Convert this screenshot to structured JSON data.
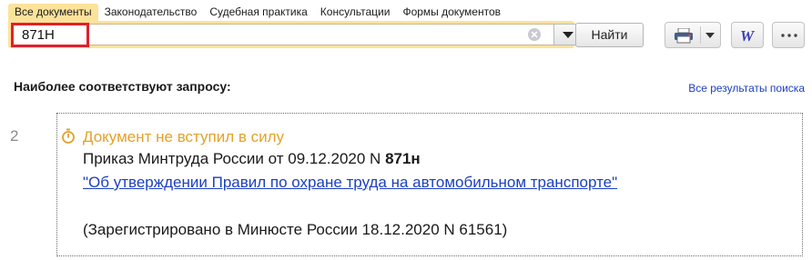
{
  "tabs": [
    {
      "label": "Все документы",
      "active": true
    },
    {
      "label": "Законодательство",
      "active": false
    },
    {
      "label": "Судебная практика",
      "active": false
    },
    {
      "label": "Консультации",
      "active": false
    },
    {
      "label": "Формы документов",
      "active": false
    }
  ],
  "search": {
    "value": "871Н",
    "find_label": "Найти"
  },
  "toolbar": {
    "word_letter": "W"
  },
  "results": {
    "heading": "Наиболее соответствуют запросу:",
    "all_link": "Все результаты поиска",
    "items": [
      {
        "number": "2",
        "status": "Документ не вступил в силу",
        "title_prefix": "Приказ Минтруда России от 09.12.2020 N ",
        "title_number": "871н",
        "link": "\"Об утверждении Правил по охране труда на автомобильном транспорте\"",
        "registered": "(Зарегистрировано в Минюсте России 18.12.2020 N 61561)"
      }
    ]
  },
  "colors": {
    "tab_active": "#fde29a",
    "highlight": "#e0202a",
    "link": "#1c3fc2",
    "status": "#e2a22a"
  }
}
